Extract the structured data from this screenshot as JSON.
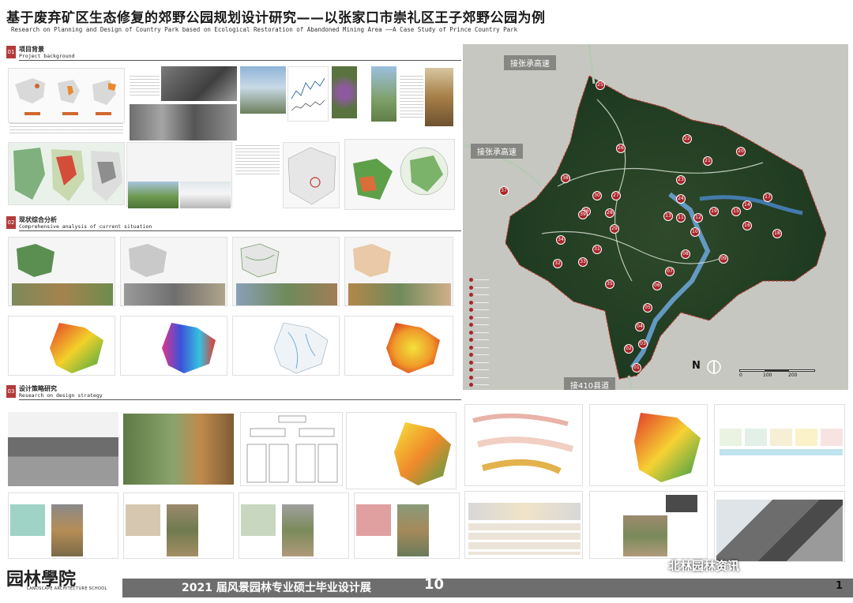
{
  "header": {
    "title_cn": "基于废弃矿区生态修复的郊野公园规划设计研究——以张家口市崇礼区王子郊野公园为例",
    "title_en": "Research on Planning and Design of Country Park based on Ecological Restoration of Abandoned Mining Area   ——A Case Study of Prince Country Park"
  },
  "sections": [
    {
      "num": "01",
      "cn": "项目背景",
      "en": "Project background"
    },
    {
      "num": "02",
      "cn": "现状综合分析",
      "en": "Comprehensive analysis of current situation"
    },
    {
      "num": "03",
      "cn": "设计策略研究",
      "en": "Research on design strategy"
    }
  ],
  "map": {
    "labels": {
      "top": "接张承高速",
      "left": "接张承高速",
      "bottom": "接410县道"
    },
    "north": "N",
    "scale": [
      "0",
      "100",
      "200"
    ],
    "markers": [
      "01",
      "02",
      "03",
      "04",
      "05",
      "06",
      "07",
      "08",
      "09",
      "10",
      "11",
      "12",
      "13",
      "14",
      "15",
      "16",
      "17",
      "18",
      "19",
      "20",
      "21",
      "22",
      "23",
      "24",
      "25",
      "26",
      "27",
      "28",
      "29",
      "30",
      "31",
      "32",
      "33",
      "34",
      "35",
      "36",
      "37",
      "38",
      "39"
    ]
  },
  "footer": {
    "school": "园林學院",
    "school_en": "LANDSCAPE ARCHITECTURE SCHOOL",
    "exhibition": "2021 届风景园林专业硕士毕业设计展",
    "num": "10",
    "page": "1",
    "wechat": "北林园林资讯"
  },
  "colors": {
    "accent": "#b33a3a",
    "marker": "#a8262a",
    "footer_bar": "#6e6e6e"
  }
}
